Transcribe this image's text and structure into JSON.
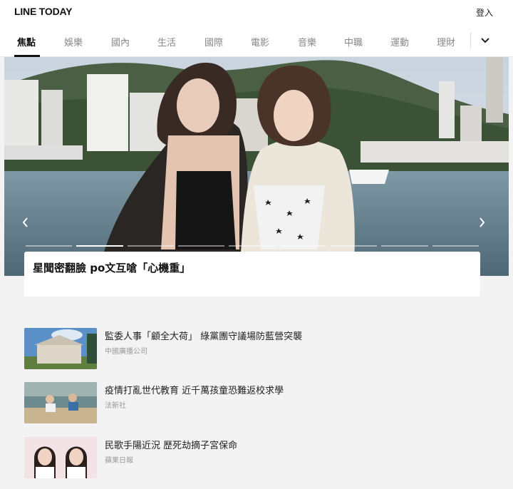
{
  "header": {
    "logo": "LINE TODAY",
    "login_label": "登入"
  },
  "tabs": [
    {
      "label": "焦點",
      "active": true
    },
    {
      "label": "娛樂"
    },
    {
      "label": "國內"
    },
    {
      "label": "生活"
    },
    {
      "label": "國際"
    },
    {
      "label": "電影"
    },
    {
      "label": "音樂"
    },
    {
      "label": "中職"
    },
    {
      "label": "運動"
    },
    {
      "label": "理財"
    }
  ],
  "more_icon": "chevron-down-icon",
  "hero": {
    "title": "星聞密翻臉 po文互嗆「心機重」",
    "prev_icon": "chevron-left-icon",
    "next_icon": "chevron-right-icon",
    "slide_count": 9,
    "active_slide": 1
  },
  "news": [
    {
      "title": "監委人事「顧全大荷」 綠黨團守議場防藍營突襲",
      "source": "中國廣播公司"
    },
    {
      "title": "疫情打亂世代教育 近千萬孩童恐難返校求學",
      "source": "法新社"
    },
    {
      "title": "民歌手陽近況 歷死劫摘子宮保命",
      "source": "蘋果日報"
    }
  ],
  "colors": {
    "accent": "#111111",
    "background": "#f3f3f3",
    "card": "#ffffff"
  }
}
